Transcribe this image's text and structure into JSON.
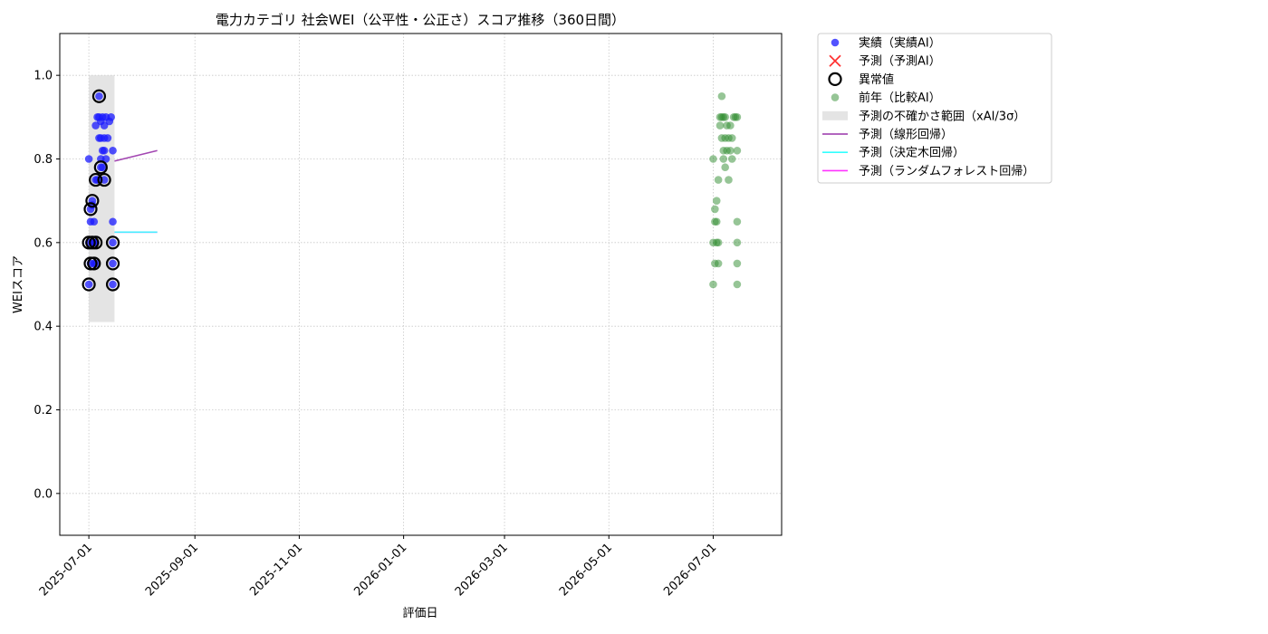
{
  "chart_data": {
    "type": "scatter",
    "title": "電力カテゴリ 社会WEI（公平性・公正さ）スコア推移（360日間）",
    "xlabel": "評価日",
    "ylabel": "WEIスコア",
    "xlim": [
      "2025-06-14",
      "2026-08-10"
    ],
    "ylim": [
      -0.1,
      1.1
    ],
    "x_ticks": [
      "2025-07-01",
      "2025-09-01",
      "2025-11-01",
      "2026-01-01",
      "2026-03-01",
      "2026-05-01",
      "2026-07-01"
    ],
    "y_ticks": [
      "0.0",
      "0.2",
      "0.4",
      "0.6",
      "0.8",
      "1.0"
    ],
    "grid": true,
    "legend_position": "outside-top-right",
    "colors": {
      "actual": "#1a1aff",
      "predicted": "#ff3333",
      "anomaly": "#000000",
      "previous_year": "#2e8b2e",
      "uncertainty": "#d9d9d9",
      "linear": "#9933aa",
      "decision_tree": "#33ffff",
      "random_forest": "#ff33ff"
    },
    "legend": [
      {
        "key": "actual",
        "label": "実績（実績AI）",
        "marker": "dot"
      },
      {
        "key": "predicted",
        "label": "予測（予測AI）",
        "marker": "x"
      },
      {
        "key": "anomaly",
        "label": "異常値",
        "marker": "ring"
      },
      {
        "key": "previous_year",
        "label": "前年（比較AI）",
        "marker": "dot-light"
      },
      {
        "key": "uncertainty",
        "label": "予測の不確かさ範囲（xAI/3σ）",
        "marker": "band"
      },
      {
        "key": "linear",
        "label": "予測（線形回帰）",
        "marker": "line"
      },
      {
        "key": "decision_tree",
        "label": "予測（決定木回帰）",
        "marker": "line"
      },
      {
        "key": "random_forest",
        "label": "予測（ランダムフォレスト回帰）",
        "marker": "line"
      }
    ],
    "series": [
      {
        "key": "actual",
        "points": [
          [
            "2025-07-01",
            0.5
          ],
          [
            "2025-07-01",
            0.6
          ],
          [
            "2025-07-01",
            0.8
          ],
          [
            "2025-07-02",
            0.55
          ],
          [
            "2025-07-02",
            0.65
          ],
          [
            "2025-07-02",
            0.68
          ],
          [
            "2025-07-03",
            0.6
          ],
          [
            "2025-07-03",
            0.7
          ],
          [
            "2025-07-03",
            0.69
          ],
          [
            "2025-07-04",
            0.55
          ],
          [
            "2025-07-04",
            0.6
          ],
          [
            "2025-07-04",
            0.65
          ],
          [
            "2025-07-05",
            0.55
          ],
          [
            "2025-07-05",
            0.6
          ],
          [
            "2025-07-05",
            0.75
          ],
          [
            "2025-07-05",
            0.88
          ],
          [
            "2025-07-06",
            0.9
          ],
          [
            "2025-07-06",
            0.75
          ],
          [
            "2025-07-07",
            0.95
          ],
          [
            "2025-07-07",
            0.85
          ],
          [
            "2025-07-07",
            0.9
          ],
          [
            "2025-07-08",
            0.78
          ],
          [
            "2025-07-08",
            0.8
          ],
          [
            "2025-07-08",
            0.85
          ],
          [
            "2025-07-08",
            0.89
          ],
          [
            "2025-07-09",
            0.82
          ],
          [
            "2025-07-09",
            0.78
          ],
          [
            "2025-07-09",
            0.9
          ],
          [
            "2025-07-10",
            0.85
          ],
          [
            "2025-07-10",
            0.75
          ],
          [
            "2025-07-10",
            0.82
          ],
          [
            "2025-07-10",
            0.88
          ],
          [
            "2025-07-11",
            0.9
          ],
          [
            "2025-07-11",
            0.8
          ],
          [
            "2025-07-12",
            0.85
          ],
          [
            "2025-07-13",
            0.89
          ],
          [
            "2025-07-14",
            0.9
          ],
          [
            "2025-07-15",
            0.65
          ],
          [
            "2025-07-15",
            0.6
          ],
          [
            "2025-07-15",
            0.55
          ],
          [
            "2025-07-15",
            0.5
          ],
          [
            "2025-07-15",
            0.82
          ]
        ]
      },
      {
        "key": "anomaly",
        "points": [
          [
            "2025-07-01",
            0.5
          ],
          [
            "2025-07-01",
            0.6
          ],
          [
            "2025-07-02",
            0.55
          ],
          [
            "2025-07-02",
            0.68
          ],
          [
            "2025-07-03",
            0.7
          ],
          [
            "2025-07-03",
            0.6
          ],
          [
            "2025-07-04",
            0.55
          ],
          [
            "2025-07-05",
            0.6
          ],
          [
            "2025-07-05",
            0.75
          ],
          [
            "2025-07-07",
            0.95
          ],
          [
            "2025-07-08",
            0.78
          ],
          [
            "2025-07-10",
            0.75
          ],
          [
            "2025-07-15",
            0.6
          ],
          [
            "2025-07-15",
            0.55
          ],
          [
            "2025-07-15",
            0.5
          ]
        ]
      },
      {
        "key": "previous_year",
        "points": [
          [
            "2026-07-01",
            0.5
          ],
          [
            "2026-07-01",
            0.6
          ],
          [
            "2026-07-01",
            0.8
          ],
          [
            "2026-07-02",
            0.55
          ],
          [
            "2026-07-02",
            0.65
          ],
          [
            "2026-07-02",
            0.68
          ],
          [
            "2026-07-03",
            0.6
          ],
          [
            "2026-07-03",
            0.7
          ],
          [
            "2026-07-03",
            0.65
          ],
          [
            "2026-07-04",
            0.55
          ],
          [
            "2026-07-04",
            0.6
          ],
          [
            "2026-07-04",
            0.75
          ],
          [
            "2026-07-05",
            0.9
          ],
          [
            "2026-07-05",
            0.88
          ],
          [
            "2026-07-06",
            0.95
          ],
          [
            "2026-07-06",
            0.9
          ],
          [
            "2026-07-06",
            0.85
          ],
          [
            "2026-07-07",
            0.8
          ],
          [
            "2026-07-07",
            0.82
          ],
          [
            "2026-07-07",
            0.9
          ],
          [
            "2026-07-08",
            0.78
          ],
          [
            "2026-07-08",
            0.85
          ],
          [
            "2026-07-08",
            0.9
          ],
          [
            "2026-07-09",
            0.82
          ],
          [
            "2026-07-09",
            0.88
          ],
          [
            "2026-07-10",
            0.75
          ],
          [
            "2026-07-10",
            0.85
          ],
          [
            "2026-07-11",
            0.88
          ],
          [
            "2026-07-11",
            0.82
          ],
          [
            "2026-07-12",
            0.8
          ],
          [
            "2026-07-12",
            0.85
          ],
          [
            "2026-07-13",
            0.9
          ],
          [
            "2026-07-14",
            0.9
          ],
          [
            "2026-07-15",
            0.65
          ],
          [
            "2026-07-15",
            0.6
          ],
          [
            "2026-07-15",
            0.55
          ],
          [
            "2026-07-15",
            0.5
          ],
          [
            "2026-07-15",
            0.82
          ],
          [
            "2026-07-15",
            0.9
          ]
        ]
      }
    ],
    "uncertainty_band": {
      "x": [
        "2025-07-01",
        "2025-07-16"
      ],
      "y": [
        0.41,
        1.0
      ]
    },
    "trend_lines": [
      {
        "key": "linear",
        "points": [
          [
            "2025-07-16",
            0.795
          ],
          [
            "2025-08-10",
            0.82
          ]
        ]
      },
      {
        "key": "random_forest",
        "points": [
          [
            "2025-07-16",
            0.625
          ],
          [
            "2025-08-10",
            0.625
          ]
        ]
      },
      {
        "key": "decision_tree",
        "points": [
          [
            "2025-07-16",
            0.625
          ],
          [
            "2025-08-10",
            0.625
          ]
        ]
      }
    ]
  }
}
